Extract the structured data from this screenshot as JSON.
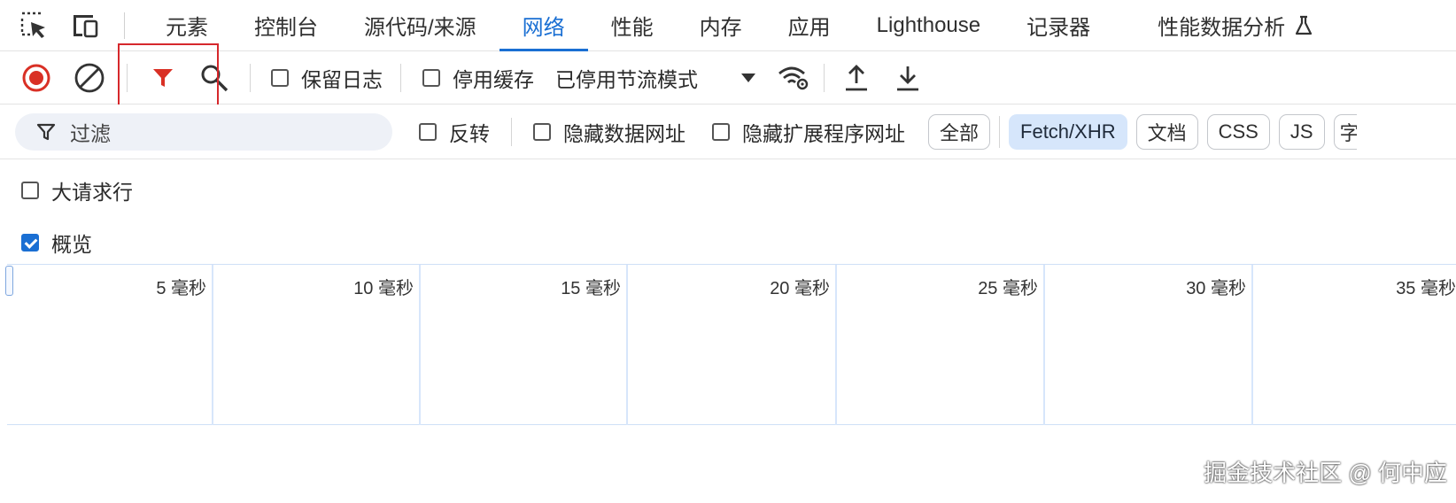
{
  "tabs": [
    "元素",
    "控制台",
    "源代码/来源",
    "网络",
    "性能",
    "内存",
    "应用",
    "Lighthouse",
    "记录器",
    "性能数据分析"
  ],
  "active_tab": "网络",
  "toolbar": {
    "preserve_log_label": "保留日志",
    "disable_cache_label": "停用缓存",
    "throttling_label": "已停用节流模式"
  },
  "filter": {
    "placeholder": "过滤",
    "invert_label": "反转",
    "hide_data_urls_label": "隐藏数据网址",
    "hide_extension_urls_label": "隐藏扩展程序网址",
    "type_chips": [
      "全部",
      "Fetch/XHR",
      "文档",
      "CSS",
      "JS",
      "字"
    ],
    "selected_chip": "Fetch/XHR"
  },
  "options": {
    "big_request_rows_label": "大请求行",
    "overview_label": "概览"
  },
  "timeline": {
    "ticks": [
      "5 毫秒",
      "10 毫秒",
      "15 毫秒",
      "20 毫秒",
      "25 毫秒",
      "30 毫秒",
      "35 毫秒"
    ]
  },
  "watermark": "掘金技术社区 @ 何中应",
  "colors": {
    "accent": "#1a6fd3",
    "record": "#d93025",
    "filter_active": "#d93025",
    "highlight_box": "#d6282c"
  }
}
